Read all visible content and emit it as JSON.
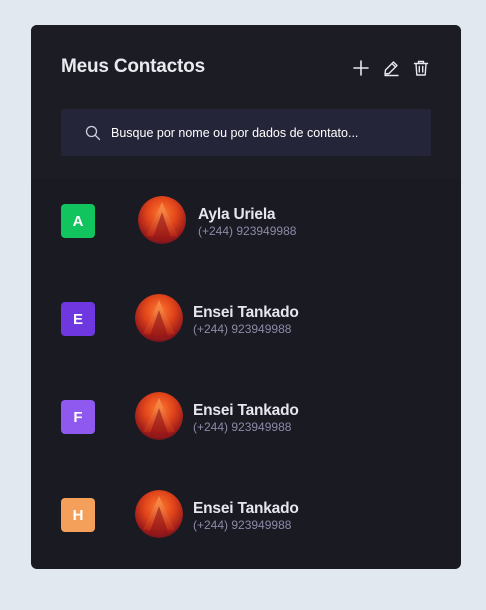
{
  "header": {
    "title": "Meus Contactos",
    "icons": [
      "plus-icon",
      "edit-icon",
      "trash-icon"
    ]
  },
  "search": {
    "placeholder": "Busque por nome ou por dados de contato..."
  },
  "groups": [
    {
      "letter": "A",
      "color": "#12c45e",
      "contact": {
        "name": "Ayla Uriela",
        "phone": "(+244) 923949988"
      }
    },
    {
      "letter": "E",
      "color": "#6e37e0",
      "contact": {
        "name": "Ensei Tankado",
        "phone": "(+244) 923949988"
      }
    },
    {
      "letter": "F",
      "color": "#8f58ef",
      "contact": {
        "name": "Ensei Tankado",
        "phone": "(+244) 923949988"
      }
    },
    {
      "letter": "H",
      "color": "#f5a05a",
      "contact": {
        "name": "Ensei Tankado",
        "phone": "(+244) 923949988"
      }
    }
  ],
  "colors": {
    "panel_bg": "#1a1a22",
    "search_bg": "#25253a",
    "name_text": "#e6e6ee",
    "phone_text": "#8b8aa8"
  }
}
